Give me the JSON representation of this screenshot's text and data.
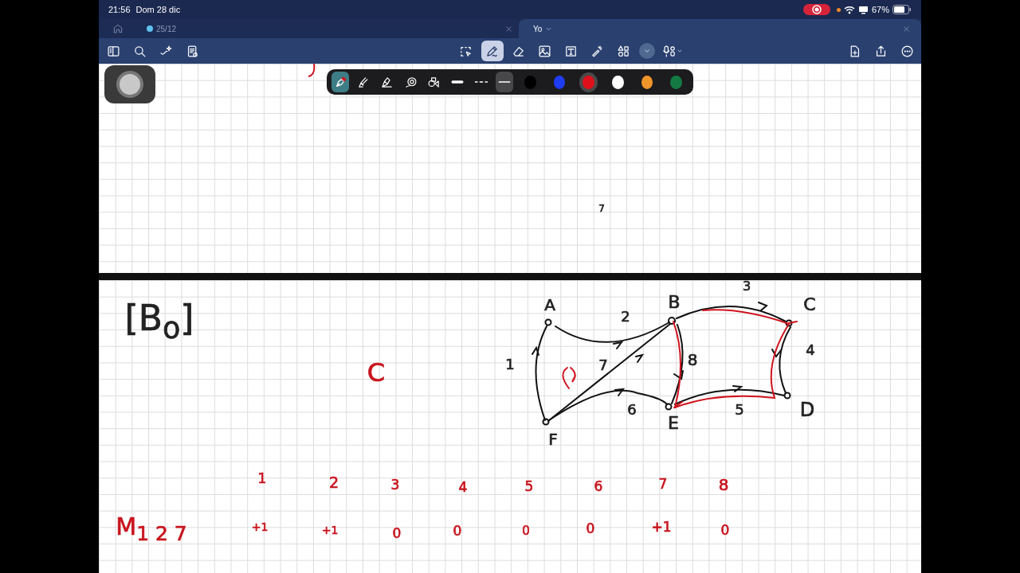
{
  "status_bar": {
    "time": "21:56",
    "date": "Dom 28 dic",
    "battery": "67%"
  },
  "tabs": [
    {
      "label": "25/12",
      "selected": false
    },
    {
      "label": "Yo",
      "selected": true
    }
  ],
  "toolbar": {
    "tools": [
      {
        "selected": false
      },
      {
        "selected": true
      },
      {
        "selected": false
      },
      {
        "selected": false
      },
      {
        "selected": false
      },
      {
        "selected": false
      },
      {
        "selected": false
      }
    ]
  },
  "pen_toolbar": {
    "tools": [
      {
        "selected": true
      },
      {
        "selected": false
      },
      {
        "selected": false
      },
      {
        "selected": false
      },
      {
        "selected": false
      }
    ],
    "strokes": [
      {
        "selected": false
      },
      {
        "selected": false
      },
      {
        "selected": true
      }
    ],
    "colors": [
      {
        "color": "#000000",
        "selected": false
      },
      {
        "color": "#1f3cf5",
        "selected": false
      },
      {
        "color": "#e0101a",
        "selected": true
      },
      {
        "color": "#ffffff",
        "selected": false
      },
      {
        "color": "#f0952a",
        "selected": false
      },
      {
        "color": "#147a44",
        "selected": false
      }
    ]
  },
  "notes": [
    {
      "text": "7",
      "color": "#222222"
    },
    {
      "text": "[B$_{o}$]",
      "color": "#222222"
    },
    {
      "text": "C",
      "color": "#c8141e"
    },
    {
      "text": "A",
      "color": "#222222"
    },
    {
      "text": "2",
      "color": "#222222"
    },
    {
      "text": "B",
      "color": "#222222"
    },
    {
      "text": "3",
      "color": "#222222"
    },
    {
      "text": "C",
      "color": "#222222"
    },
    {
      "text": "1",
      "color": "#222222"
    },
    {
      "text": "7",
      "color": "#222222"
    },
    {
      "text": "8",
      "color": "#222222"
    },
    {
      "text": "4",
      "color": "#222222"
    },
    {
      "text": "6",
      "color": "#222222"
    },
    {
      "text": "5",
      "color": "#222222"
    },
    {
      "text": "E",
      "color": "#222222"
    },
    {
      "text": "D",
      "color": "#222222"
    },
    {
      "text": "F",
      "color": "#222222"
    },
    {
      "text": "1",
      "color": "#c8141e"
    },
    {
      "text": "2",
      "color": "#c8141e"
    },
    {
      "text": "3",
      "color": "#c8141e"
    },
    {
      "text": "4",
      "color": "#c8141e"
    },
    {
      "text": "5",
      "color": "#c8141e"
    },
    {
      "text": "6",
      "color": "#c8141e"
    },
    {
      "text": "7",
      "color": "#c8141e"
    },
    {
      "text": "8",
      "color": "#c8141e"
    },
    {
      "text": "M$_{1 2 7}$",
      "color": "#c8141e"
    },
    {
      "text": "+1",
      "color": "#c8141e"
    },
    {
      "text": "+1",
      "color": "#c8141e"
    },
    {
      "text": "0",
      "color": "#c8141e"
    },
    {
      "text": "0",
      "color": "#c8141e"
    },
    {
      "text": "0",
      "color": "#c8141e"
    },
    {
      "text": "0",
      "color": "#c8141e"
    },
    {
      "text": "+1",
      "color": "#c8141e"
    },
    {
      "text": "0",
      "color": "#c8141e"
    }
  ]
}
